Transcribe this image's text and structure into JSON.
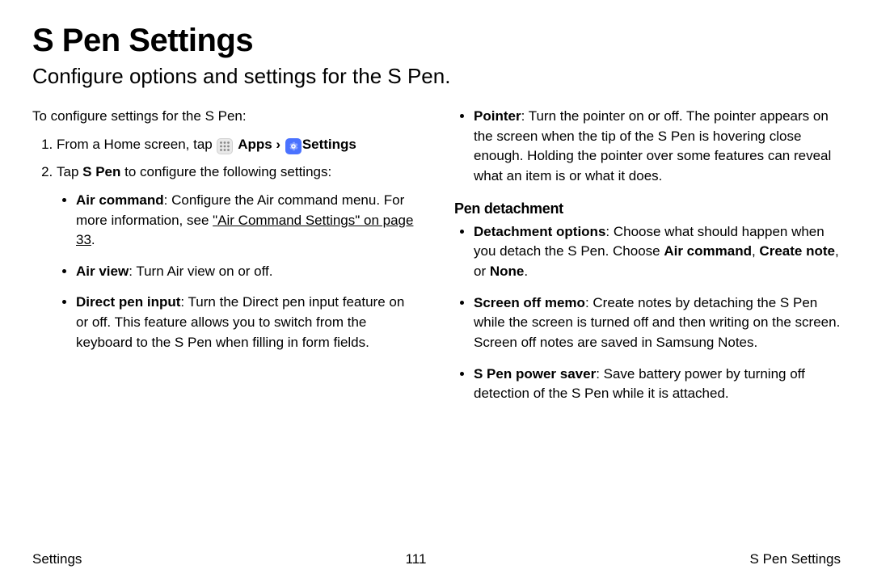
{
  "title": "S Pen Settings",
  "subtitle": "Configure options and settings for the S Pen.",
  "left": {
    "intro": "To configure settings for the S Pen:",
    "step1_pre": "From a Home screen, tap ",
    "apps_label": "Apps",
    "separator": " › ",
    "settings_label": "Settings",
    "step2_pre": "Tap ",
    "step2_bold": "S Pen",
    "step2_post": " to configure the following settings:",
    "b1_bold": "Air command",
    "b1_text": ": Configure the Air command menu. For more information, see ",
    "b1_link": "\"Air Command Settings\" on page 33",
    "b1_end": ".",
    "b2_bold": "Air view",
    "b2_text": ": Turn Air view on or off.",
    "b3_bold": "Direct pen input",
    "b3_text": ": Turn the Direct pen input feature on or off. This feature allows you to switch from the keyboard to the S Pen when filling in form fields."
  },
  "right": {
    "pointer_bold": "Pointer",
    "pointer_text": ": Turn the pointer on or off. The pointer appears on the screen when the tip of the S Pen is hovering close enough. Holding the pointer over some features can reveal what an item is or what it does.",
    "subhead": "Pen detachment",
    "d1_bold": "Detachment options",
    "d1_text": ": Choose what should happen when you detach the S Pen. Choose ",
    "d1_opt1": "Air command",
    "d1_comma": ", ",
    "d1_opt2": "Create note",
    "d1_or": ", or ",
    "d1_opt3": "None",
    "d1_end": ".",
    "d2_bold": "Screen off memo",
    "d2_text": ": Create notes by detaching the S Pen while the screen is turned off and then writing on the screen. Screen off notes are saved in Samsung Notes.",
    "d3_bold": "S Pen power saver",
    "d3_text": ": Save battery power by turning off detection of the S Pen while it is attached."
  },
  "footer": {
    "left": "Settings",
    "center": "111",
    "right": "S Pen Settings"
  }
}
